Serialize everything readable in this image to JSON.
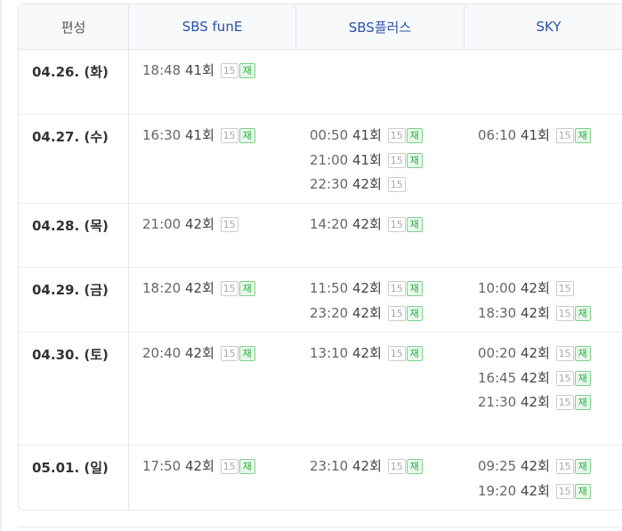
{
  "header": {
    "col0": "편성",
    "ch1": "SBS funE",
    "ch2": "SBS플러스",
    "ch3": "SKY"
  },
  "badges": {
    "age": "15",
    "rerun": "재"
  },
  "colors": {
    "channel_header": "#2a52a8",
    "rerun_badge": "#27ae3c",
    "age_badge": "#aaaaaa"
  },
  "rows": [
    {
      "date": "04.26. (화)",
      "ch1": [
        {
          "time": "18:48",
          "ep": "41회",
          "re": true
        }
      ],
      "ch2": [],
      "ch3": []
    },
    {
      "date": "04.27. (수)",
      "ch1": [
        {
          "time": "16:30",
          "ep": "41회",
          "re": true
        }
      ],
      "ch2": [
        {
          "time": "00:50",
          "ep": "41회",
          "re": true
        },
        {
          "time": "21:00",
          "ep": "41회",
          "re": true
        },
        {
          "time": "22:30",
          "ep": "42회",
          "re": false
        }
      ],
      "ch3": [
        {
          "time": "06:10",
          "ep": "41회",
          "re": true
        }
      ]
    },
    {
      "date": "04.28. (목)",
      "ch1": [
        {
          "time": "21:00",
          "ep": "42회",
          "re": false
        }
      ],
      "ch2": [
        {
          "time": "14:20",
          "ep": "42회",
          "re": true
        }
      ],
      "ch3": []
    },
    {
      "date": "04.29. (금)",
      "ch1": [
        {
          "time": "18:20",
          "ep": "42회",
          "re": true
        }
      ],
      "ch2": [
        {
          "time": "11:50",
          "ep": "42회",
          "re": true
        },
        {
          "time": "23:20",
          "ep": "42회",
          "re": true
        }
      ],
      "ch3": [
        {
          "time": "10:00",
          "ep": "42회",
          "re": false
        },
        {
          "time": "18:30",
          "ep": "42회",
          "re": true
        }
      ]
    },
    {
      "date": "04.30. (토)",
      "ch1": [
        {
          "time": "20:40",
          "ep": "42회",
          "re": true
        }
      ],
      "ch2": [
        {
          "time": "13:10",
          "ep": "42회",
          "re": true
        }
      ],
      "ch3": [
        {
          "time": "00:20",
          "ep": "42회",
          "re": true
        },
        {
          "time": "16:45",
          "ep": "42회",
          "re": true
        },
        {
          "time": "21:30",
          "ep": "42회",
          "re": true
        }
      ]
    },
    {
      "date": "05.01. (일)",
      "ch1": [
        {
          "time": "17:50",
          "ep": "42회",
          "re": true
        }
      ],
      "ch2": [
        {
          "time": "23:10",
          "ep": "42회",
          "re": true
        }
      ],
      "ch3": [
        {
          "time": "09:25",
          "ep": "42회",
          "re": true
        },
        {
          "time": "19:20",
          "ep": "42회",
          "re": true
        }
      ]
    }
  ]
}
